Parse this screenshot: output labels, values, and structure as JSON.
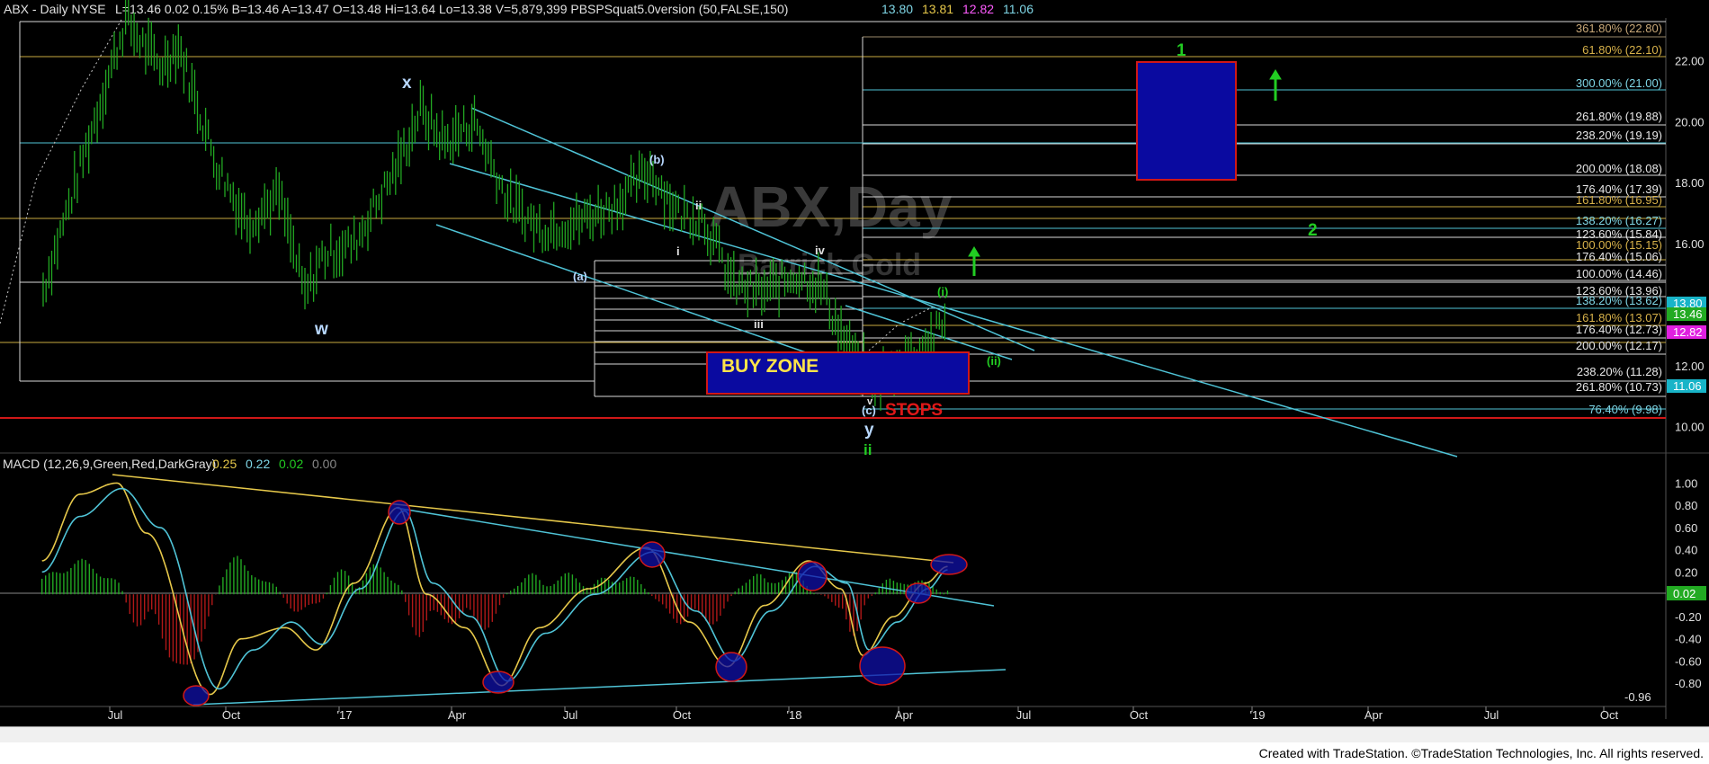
{
  "header": {
    "symbol": "ABX - Daily  NYSE",
    "stats": "L=13.46  0.02  0.15%  B=13.46  A=13.47  O=13.48  Hi=13.64  Lo=13.38  V=5,879,399  PBSPSquat5.0version (50,FALSE,150)",
    "study_values": [
      {
        "text": "13.80",
        "color": "#7fd6e6"
      },
      {
        "text": "13.81",
        "color": "#e6c84a"
      },
      {
        "text": "12.82",
        "color": "#ff5cff"
      },
      {
        "text": "11.06",
        "color": "#7fd6e6"
      }
    ]
  },
  "watermark": {
    "line1": "ABX,Day",
    "line2": "Barrick Gold"
  },
  "price_axis": [
    "22.00",
    "20.00",
    "18.00",
    "16.00",
    "14.00",
    "12.00",
    "10.00"
  ],
  "price_tags": [
    {
      "text": "13.80",
      "color": "#18b4c8"
    },
    {
      "text": "13.46",
      "color": "#22aa22"
    },
    {
      "text": "12.82",
      "color": "#e020e0"
    },
    {
      "text": "11.06",
      "color": "#18b4c8"
    }
  ],
  "fib_labels": [
    {
      "text": "361.80% (22.80)",
      "color": "#c8a878"
    },
    {
      "text": "61.80% (22.10)",
      "color": "#d8b24a"
    },
    {
      "text": "300.00% (21.00)",
      "color": "#7fd6e6"
    },
    {
      "text": "261.80% (19.88)",
      "color": "#e8e8e8"
    },
    {
      "text": "238.20% (19.19)",
      "color": "#e8e8e8"
    },
    {
      "text": "200.00% (18.08)",
      "color": "#e8e8e8"
    },
    {
      "text": "176.40% (17.39)",
      "color": "#e8e8e8"
    },
    {
      "text": "161.80% (16.95)",
      "color": "#d8b24a"
    },
    {
      "text": "138.20% (16.27)",
      "color": "#7fd6e6"
    },
    {
      "text": "123.60% (15.84)",
      "color": "#e8e8e8"
    },
    {
      "text": "100.00% (15.15)",
      "color": "#d8b24a"
    },
    {
      "text": "176.40% (15.06)",
      "color": "#e8e8e8"
    },
    {
      "text": "100.00% (14.46)",
      "color": "#e8e8e8"
    },
    {
      "text": "123.60% (13.96)",
      "color": "#e8e8e8"
    },
    {
      "text": "138.20% (13.62)",
      "color": "#7fd6e6"
    },
    {
      "text": "161.80% (13.07)",
      "color": "#d8b24a"
    },
    {
      "text": "176.40% (12.73)",
      "color": "#e8e8e8"
    },
    {
      "text": "200.00% (12.17)",
      "color": "#e8e8e8"
    },
    {
      "text": "238.20% (11.28)",
      "color": "#e8e8e8"
    },
    {
      "text": "261.80% (10.73)",
      "color": "#e8e8e8"
    },
    {
      "text": "76.40% (9.98)",
      "color": "#7fd6e6"
    }
  ],
  "wave_labels": {
    "x": "x",
    "w": "w",
    "b": "(b)",
    "a": "(a)",
    "c": "(c)",
    "i_small": "i",
    "ii_small": "ii",
    "iii": "iii",
    "iv": "iv",
    "v": "v",
    "y": "y",
    "ii_green": "ii",
    "i_paren": "(i)",
    "ii_paren": "(ii)",
    "target1": "1",
    "target2": "2"
  },
  "annotations": {
    "buy_zone": "BUY ZONE",
    "stops": "STOPS"
  },
  "macd": {
    "title": "MACD (12,26,9,Green,Red,DarkGray)",
    "values": [
      {
        "text": "0.25",
        "color": "#e6c84a"
      },
      {
        "text": "0.22",
        "color": "#7fd6e6"
      },
      {
        "text": "0.02",
        "color": "#22cc22"
      },
      {
        "text": "0.00",
        "color": "#888888"
      }
    ],
    "axis": [
      "1.00",
      "0.80",
      "0.60",
      "0.40",
      "0.20",
      "-0.20",
      "-0.40",
      "-0.60",
      "-0.80"
    ],
    "low_label": "-0.96",
    "tag": "0.02"
  },
  "time_axis": [
    "Jul",
    "Oct",
    "'17",
    "Apr",
    "Jul",
    "Oct",
    "'18",
    "Apr",
    "Jul",
    "Oct",
    "'19",
    "Apr",
    "Jul",
    "Oct"
  ],
  "footer": "Created with TradeStation. ©TradeStation Technologies, Inc. All rights reserved.",
  "colors": {
    "price": "#22a822",
    "channel": "#4fc3d6",
    "fib_white": "#d8d8d8",
    "fib_gold": "#c8aa40",
    "stops": "#d01818",
    "box": "#0a0aa0",
    "box_border": "#d01818",
    "macd_fast": "#e6c84a",
    "macd_slow": "#4fc3d6",
    "hist_pos": "#22a822",
    "hist_neg": "#b01818",
    "target_green": "#22cc22"
  },
  "chart_data": [
    {
      "type": "line",
      "title": "ABX - Daily  NYSE",
      "xlabel": "",
      "ylabel": "",
      "ylim": [
        9.4,
        23.4
      ],
      "x_ticks": [
        "Jul",
        "Oct",
        "'17",
        "Apr",
        "Jul",
        "Oct",
        "'18",
        "Apr",
        "Jul",
        "Oct",
        "'19",
        "Apr",
        "Jul",
        "Oct"
      ],
      "series": [
        {
          "name": "",
          "x": [
            "2016-05-02",
            "2016-06-15",
            "2016-07-08",
            "2016-08-05",
            "2016-08-20",
            "2016-09-20",
            "2016-10-15",
            "2016-11-10",
            "2016-12-01",
            "2016-12-15",
            "2017-01-10",
            "2017-02-15",
            "2017-03-05",
            "2017-03-25",
            "2017-04-18",
            "2017-05-15",
            "2017-06-10",
            "2017-07-10",
            "2017-08-10",
            "2017-09-08",
            "2017-10-01",
            "2017-10-20",
            "2017-11-15",
            "2017-12-10",
            "2018-01-05",
            "2018-01-25",
            "2018-02-15",
            "2018-03-10",
            "2018-03-30",
            "2018-04-20",
            "2018-05-08"
          ],
          "y": [
            14.5,
            20.3,
            23.3,
            21.8,
            22.5,
            18.6,
            16.7,
            17.6,
            14.3,
            15.6,
            16.0,
            18.6,
            20.4,
            19.3,
            20.0,
            17.4,
            16.5,
            16.7,
            17.3,
            18.4,
            17.0,
            16.9,
            14.6,
            14.4,
            15.0,
            14.6,
            12.6,
            11.4,
            12.2,
            12.7,
            13.46
          ]
        }
      ]
    },
    {
      "type": "line",
      "title": "MACD (12,26,9,Green,Red,DarkGray)",
      "xlabel": "",
      "ylabel": "",
      "ylim": [
        -1.0,
        1.1
      ],
      "x_ticks": [
        "Jul",
        "Oct",
        "'17",
        "Apr",
        "Jul",
        "Oct",
        "'18",
        "Apr",
        "Jul",
        "Oct",
        "'19",
        "Apr",
        "Jul",
        "Oct"
      ],
      "series": [
        {
          "name": "",
          "x": [
            "2016-05-01",
            "2016-06-01",
            "2016-07-01",
            "2016-07-25",
            "2016-09-15",
            "2016-10-10",
            "2016-11-15",
            "2016-12-10",
            "2017-01-10",
            "2017-02-15",
            "2017-03-10",
            "2017-04-10",
            "2017-05-10",
            "2017-06-10",
            "2017-07-20",
            "2017-09-05",
            "2017-10-10",
            "2017-11-10",
            "2017-12-10",
            "2018-01-15",
            "2018-02-10",
            "2018-02-28",
            "2018-03-25",
            "2018-04-20",
            "2018-05-08"
          ],
          "y": [
            0.3,
            0.9,
            1.0,
            0.55,
            -0.9,
            -0.4,
            -0.3,
            -0.5,
            0.1,
            0.78,
            0.0,
            -0.3,
            -0.82,
            -0.3,
            0.05,
            0.42,
            -0.25,
            -0.65,
            -0.1,
            0.3,
            0.05,
            -0.55,
            -0.2,
            0.1,
            0.25
          ]
        },
        {
          "name": "",
          "x": [
            "2016-05-01",
            "2016-06-01",
            "2016-07-05",
            "2016-08-05",
            "2016-09-22",
            "2016-10-20",
            "2016-11-20",
            "2016-12-15",
            "2017-01-15",
            "2017-02-20",
            "2017-03-15",
            "2017-04-15",
            "2017-05-15",
            "2017-06-15",
            "2017-07-25",
            "2017-09-10",
            "2017-10-15",
            "2017-11-15",
            "2017-12-15",
            "2018-01-20",
            "2018-02-15",
            "2018-03-05",
            "2018-03-28",
            "2018-04-22",
            "2018-05-08"
          ],
          "y": [
            0.2,
            0.7,
            0.95,
            0.6,
            -0.85,
            -0.5,
            -0.25,
            -0.45,
            0.05,
            0.75,
            0.1,
            -0.2,
            -0.78,
            -0.35,
            0.0,
            0.38,
            -0.15,
            -0.6,
            -0.15,
            0.25,
            0.1,
            -0.5,
            -0.25,
            0.05,
            0.22
          ]
        }
      ]
    }
  ]
}
